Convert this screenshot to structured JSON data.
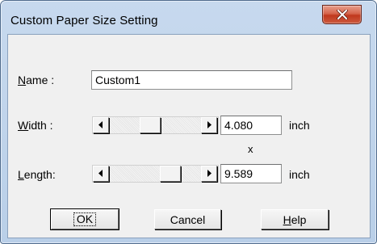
{
  "window": {
    "title": "Custom Paper Size Setting"
  },
  "icons": {
    "close": "close-icon",
    "scroll_left": "arrow-left-icon",
    "scroll_right": "arrow-right-icon"
  },
  "fields": {
    "name": {
      "label_mnemonic": "N",
      "label_rest": "ame :",
      "value": "Custom1"
    },
    "width": {
      "label_mnemonic": "W",
      "label_rest": "idth :",
      "value": "4.080",
      "unit": "inch"
    },
    "separator": "x",
    "length": {
      "label_mnemonic": "L",
      "label_rest": "ength:",
      "value": "9.589",
      "unit": "inch"
    }
  },
  "buttons": {
    "ok": "OK",
    "cancel": "Cancel",
    "help_mnemonic": "H",
    "help_rest": "elp"
  },
  "colors": {
    "title_bar": "#c7d9ee",
    "close_button": "#c7462b",
    "dialog_face": "#f0f0f0"
  }
}
